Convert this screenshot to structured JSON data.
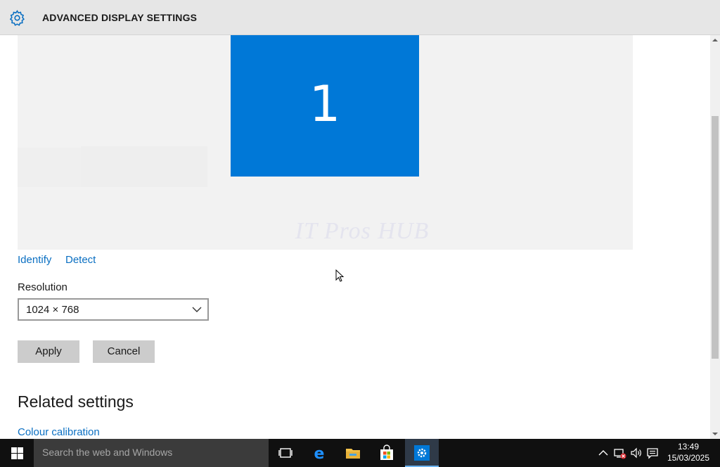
{
  "window": {
    "title": "ADVANCED DISPLAY SETTINGS"
  },
  "display_preview": {
    "monitor_number": "1",
    "watermark": "IT Pros HUB"
  },
  "links": {
    "identify": "Identify",
    "detect": "Detect"
  },
  "resolution": {
    "label": "Resolution",
    "value": "1024 × 768"
  },
  "buttons": {
    "apply": "Apply",
    "cancel": "Cancel"
  },
  "related": {
    "title": "Related settings",
    "colour_calibration": "Colour calibration"
  },
  "taskbar": {
    "search_placeholder": "Search the web and Windows",
    "apps": [
      "task-view-icon",
      "edge-icon",
      "file-explorer-icon",
      "store-icon",
      "settings-icon"
    ],
    "time": "13:49",
    "date": "15/03/2025"
  },
  "colors": {
    "accent": "#0078d7",
    "link": "#0a6fc2",
    "taskbar": "#101010"
  }
}
